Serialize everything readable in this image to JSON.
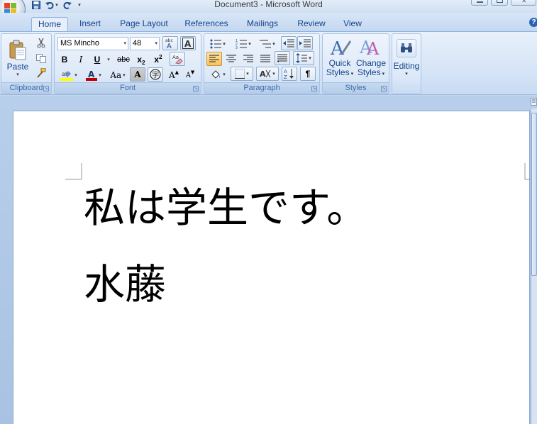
{
  "window": {
    "title": "Document3 - Microsoft Word"
  },
  "quick_access": {
    "save_icon": "save-icon",
    "undo_icon": "undo-icon",
    "redo_icon": "redo-icon"
  },
  "tabs": [
    {
      "label": "Home",
      "active": true
    },
    {
      "label": "Insert"
    },
    {
      "label": "Page Layout"
    },
    {
      "label": "References"
    },
    {
      "label": "Mailings"
    },
    {
      "label": "Review"
    },
    {
      "label": "View"
    }
  ],
  "help": {
    "glyph": "?"
  },
  "clipboard": {
    "paste_label": "Paste",
    "group_label": "Clipboard"
  },
  "font": {
    "family": "MS Mincho",
    "size": "48",
    "group_label": "Font",
    "bold": "B",
    "italic": "I",
    "underline": "U",
    "strike": "abc",
    "subscript": "x",
    "superscript": "x",
    "change_case": "Aa",
    "grow": "A",
    "shrink": "A",
    "highlight_color": "#ffff00",
    "font_color": "#c00000"
  },
  "paragraph": {
    "group_label": "Paragraph",
    "pilcrow": "¶"
  },
  "styles": {
    "quick_label": "Quick",
    "quick_label2": "Styles",
    "change_label": "Change",
    "change_label2": "Styles",
    "group_label": "Styles"
  },
  "editing": {
    "label": "Editing"
  },
  "document": {
    "line1": "私は学生です。",
    "line2": "水藤"
  },
  "colors": {
    "ribbon_text": "#15428b",
    "accent_blue": "#2a63b5"
  }
}
